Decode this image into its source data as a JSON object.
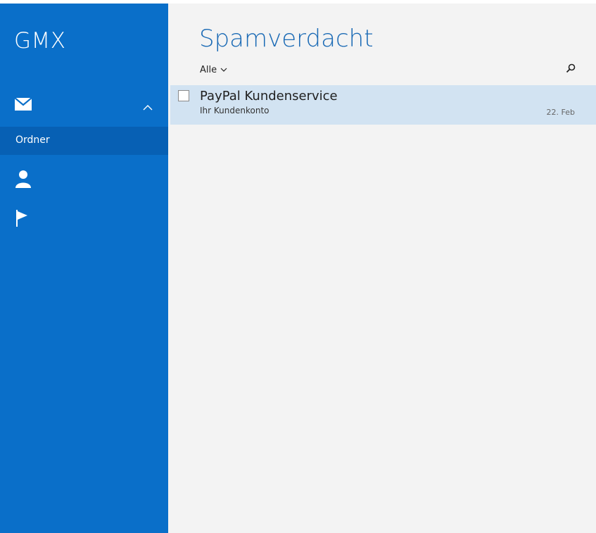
{
  "app": {
    "brand": "GMX"
  },
  "sidebar": {
    "mail": {
      "icon": "envelope-icon",
      "expand_icon": "chevron-up-icon"
    },
    "folder_label": "Ordner",
    "contacts": {
      "icon": "person-icon"
    },
    "flagged": {
      "icon": "flag-icon"
    },
    "colors": {
      "background": "#0a6fc9",
      "selected": "#0760b4"
    }
  },
  "main": {
    "title": "Spamverdacht",
    "filter": {
      "label": "Alle",
      "icon": "chevron-down-icon"
    },
    "search": {
      "icon": "search-icon"
    },
    "messages": [
      {
        "sender": "PayPal Kundenservice",
        "subject": "Ihr Kundenkonto",
        "date": "22. Feb",
        "selected": true,
        "checked": false
      }
    ],
    "colors": {
      "title": "#1a6ab5",
      "selected_row": "#d2e3f2",
      "background": "#f3f3f3"
    }
  }
}
